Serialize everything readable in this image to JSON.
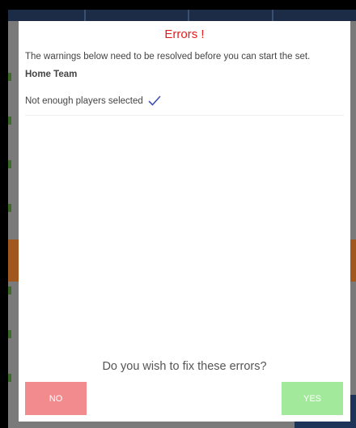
{
  "dialog": {
    "title": "Errors !",
    "message": "The warnings below need to be resolved before you can start the set.",
    "team": "Home Team",
    "errors": [
      {
        "text": "Not enough players selected",
        "icon": "checkmark-icon"
      }
    ],
    "question": "Do you wish to fix these errors?",
    "no_label": "NO",
    "yes_label": "YES"
  },
  "colors": {
    "title": "#e51c1c",
    "no_button": "#f28b8e",
    "yes_button": "#a3e99c",
    "check": "#3f51b5"
  }
}
